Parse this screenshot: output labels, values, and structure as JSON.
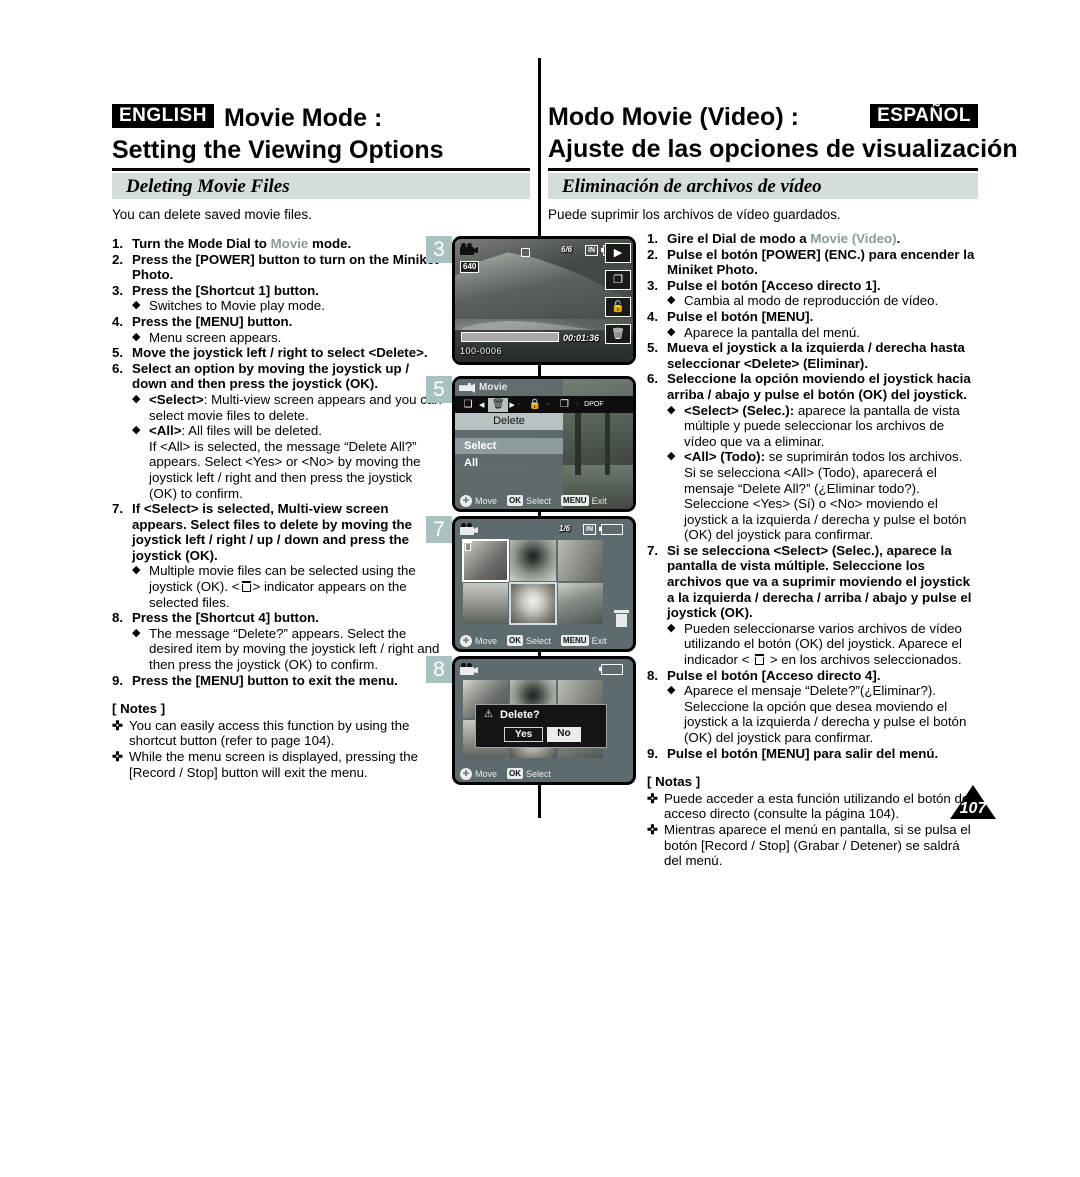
{
  "header": {
    "en_tag": "ENGLISH",
    "en_title_1": "Movie Mode :",
    "en_title_2": "Setting the Viewing Options",
    "es_tag": "ESPAÑOL",
    "es_title_1": "Modo Movie (Video) :",
    "es_title_2": "Ajuste de las opciones de visualización"
  },
  "section": {
    "en_band": "Deleting Movie Files",
    "es_band": "Eliminación de archivos de vídeo",
    "en_intro": "You can delete saved movie files.",
    "es_intro": "Puede suprimir los archivos de vídeo guardados."
  },
  "english": {
    "s1_num": "1.",
    "s1_a": "Turn the Mode Dial to ",
    "s1_mode": "Movie",
    "s1_b": " mode.",
    "s2_num": "2.",
    "s2": "Press the [POWER] button to turn on the Miniket Photo.",
    "s3_num": "3.",
    "s3": "Press the [Shortcut 1] button.",
    "s3_sub": "Switches to Movie play mode.",
    "s4_num": "4.",
    "s4": "Press the [MENU] button.",
    "s4_sub": "Menu screen appears.",
    "s5_num": "5.",
    "s5": "Move the joystick left / right to select <Delete>.",
    "s6_num": "6.",
    "s6": "Select an option by moving the joystick up / down and then press the joystick (OK).",
    "s6_sub1_b": "<Select>",
    "s6_sub1_t": ": Multi-view screen appears and you can select movie files to delete.",
    "s6_sub2_b": "<All>",
    "s6_sub2_t": ": All files will be deleted.",
    "s6_sub2_cont": "If <All> is selected, the message “Delete All?” appears. Select <Yes> or <No> by moving the joystick left / right and then press the joystick (OK) to confirm.",
    "s7_num": "7.",
    "s7": "If <Select> is selected, Multi-view screen appears. Select files to delete by moving the joystick left / right / up / down and press the joystick (OK).",
    "s7_sub_a": "Multiple movie files can be selected using the joystick (OK). <",
    "s7_sub_b": "> indicator appears on the selected files.",
    "s8_num": "8.",
    "s8": "Press the [Shortcut 4] button.",
    "s8_sub": "The message “Delete?” appears. Select the desired item by moving the joystick left / right and then press the joystick (OK) to confirm.",
    "s9_num": "9.",
    "s9": "Press the [MENU] button to exit the menu.",
    "notes_hd": "[ Notes ]",
    "note1": "You can easily access this function by using the shortcut button (refer to page 104).",
    "note2": "While the menu screen is displayed, pressing the [Record / Stop] button will exit the menu.",
    "bullet": "◆",
    "note_bullet": "✜"
  },
  "spanish": {
    "s1_num": "1.",
    "s1_a": "Gire el Dial de modo a ",
    "s1_mode": "Movie (Video)",
    "s1_b": ".",
    "s2_num": "2.",
    "s2": "Pulse el botón [POWER] (ENC.) para encender la Miniket Photo.",
    "s3_num": "3.",
    "s3": "Pulse el botón [Acceso directo 1].",
    "s3_sub": "Cambia al modo de reproducción de vídeo.",
    "s4_num": "4.",
    "s4": "Pulse el botón [MENU].",
    "s4_sub": "Aparece la pantalla del menú.",
    "s5_num": "5.",
    "s5": "Mueva el joystick a la izquierda / derecha hasta seleccionar <Delete> (Eliminar).",
    "s6_num": "6.",
    "s6": "Seleccione la opción moviendo el joystick hacia arriba / abajo y pulse el botón (OK) del joystick.",
    "s6_sub1_b": "<Select> (Selec.):",
    "s6_sub1_t": " aparece la pantalla de vista múltiple y puede seleccionar los archivos de vídeo que va a eliminar.",
    "s6_sub2_b": "<All> (Todo):",
    "s6_sub2_t": " se suprimirán todos los archivos.",
    "s6_sub2_cont": "Si se selecciona <All> (Todo), aparecerá el mensaje “Delete All?” (¿Eliminar todo?). Seleccione <Yes> (Sí) o <No> moviendo el joystick a la izquierda / derecha y pulse el botón (OK) del joystick para confirmar.",
    "s7_num": "7.",
    "s7": "Si se selecciona <Select> (Selec.), aparece la pantalla de vista múltiple. Seleccione los archivos que va a suprimir moviendo el joystick a la izquierda / derecha / arriba / abajo y pulse el joystick (OK).",
    "s7_sub_a": "Pueden seleccionarse varios archivos de vídeo utilizando el botón (OK) del joystick. Aparece el indicador < ",
    "s7_sub_b": " > en los archivos seleccionados.",
    "s8_num": "8.",
    "s8": "Pulse el botón [Acceso directo 4].",
    "s8_sub": "Aparece el mensaje “Delete?”(¿Eliminar?). Seleccione la opción que desea moviendo el joystick a la izquierda / derecha y pulse el botón (OK) del joystick para confirmar.",
    "s9_num": "9.",
    "s9": "Pulse el botón [MENU] para salir del menú.",
    "notes_hd": "[ Notas ]",
    "note1": "Puede acceder a esta función utilizando el botón de acceso directo (consulte la página 104).",
    "note2": "Mientras aparece el menú en pantalla, si se pulsa el botón [Record / Stop] (Grabar / Detener) se saldrá del menú.",
    "bullet": "◆",
    "note_bullet": "✜"
  },
  "screens": {
    "s3": {
      "badge": "3",
      "counter": "6/6",
      "storage": "IN",
      "resolution": "640",
      "timecode": "00:01:36",
      "filename": "100-0006",
      "side_icons": [
        "play-icon",
        "multiview-icon",
        "unlock-icon",
        "trash-icon"
      ],
      "side_glyphs": [
        "▶",
        "❏",
        "🔓",
        "🗑"
      ]
    },
    "s5": {
      "badge": "5",
      "title": "Movie",
      "tab_label": "Delete",
      "items": [
        "Select",
        "All"
      ],
      "selected_item": "Select",
      "hint_move": "Move",
      "hint_ok_key": "OK",
      "hint_ok": "Select",
      "hint_menu_key": "MENU",
      "hint_menu": "Exit"
    },
    "s7": {
      "badge": "7",
      "counter": "1/6",
      "storage": "IN",
      "hint_move": "Move",
      "hint_ok_key": "OK",
      "hint_ok": "Select",
      "hint_menu_key": "MENU",
      "hint_menu": "Exit"
    },
    "s8": {
      "badge": "8",
      "dialog_text": "Delete?",
      "yes": "Yes",
      "no": "No",
      "selected": "Yes",
      "hint_move": "Move",
      "hint_ok_key": "OK",
      "hint_ok": "Select"
    }
  },
  "page_number": "107",
  "colors": {
    "band": "#d4ddd7",
    "badge": "#a9c2c1",
    "mode_gray": "#8a9a9a",
    "ink": "#000000"
  }
}
